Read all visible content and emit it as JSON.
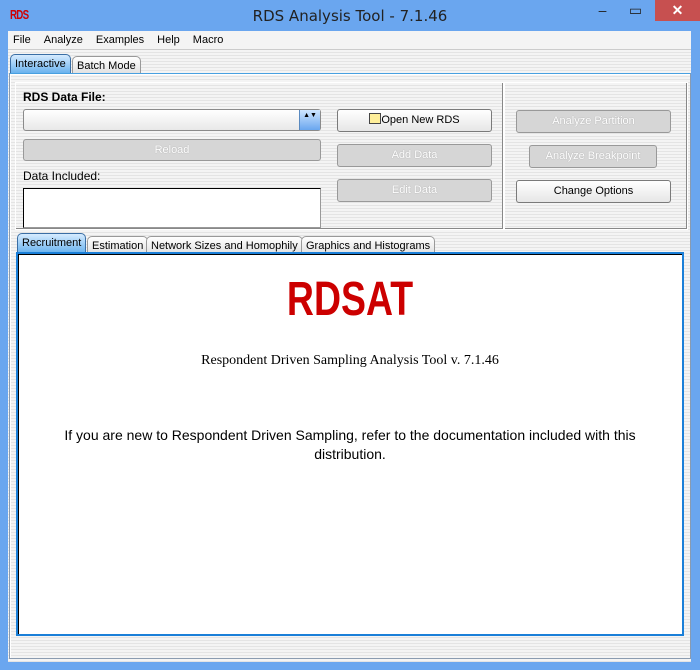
{
  "window": {
    "title": "RDS Analysis Tool - 7.1.46",
    "icon_text": "RDS",
    "minimize": "–",
    "maximize": "▭",
    "close": "✕"
  },
  "menu": [
    "File",
    "Analyze",
    "Examples",
    "Help",
    "Macro"
  ],
  "top_tabs": [
    {
      "label": "Interactive",
      "selected": true
    },
    {
      "label": "Batch Mode",
      "selected": false
    }
  ],
  "data_file": {
    "label": "RDS Data File:",
    "value": "",
    "spinner": "▲▼"
  },
  "buttons": {
    "reload": "Reload",
    "open_new": "Open New RDS",
    "add_data": "Add Data",
    "edit_data": "Edit Data",
    "analyze_partition": "Analyze Partition",
    "analyze_breakpoint": "Analyze Breakpoint",
    "change_options": "Change Options"
  },
  "data_included": {
    "label": "Data Included:",
    "value": ""
  },
  "inner_tabs": [
    {
      "label": "Recruitment",
      "selected": true
    },
    {
      "label": "Estimation"
    },
    {
      "label": "Network Sizes and Homophily"
    },
    {
      "label": "Graphics and Histograms"
    }
  ],
  "content": {
    "logo": "RDSAT",
    "subtitle": "Respondent Driven Sampling Analysis Tool v. 7.1.46",
    "message": "If you are new to Respondent Driven Sampling, refer to the documentation included with this distribution."
  },
  "colors": {
    "titlebar": "#6aa6ef",
    "close": "#c75050",
    "logo": "#cc0000",
    "tab_selected": "#6ab2ee"
  }
}
